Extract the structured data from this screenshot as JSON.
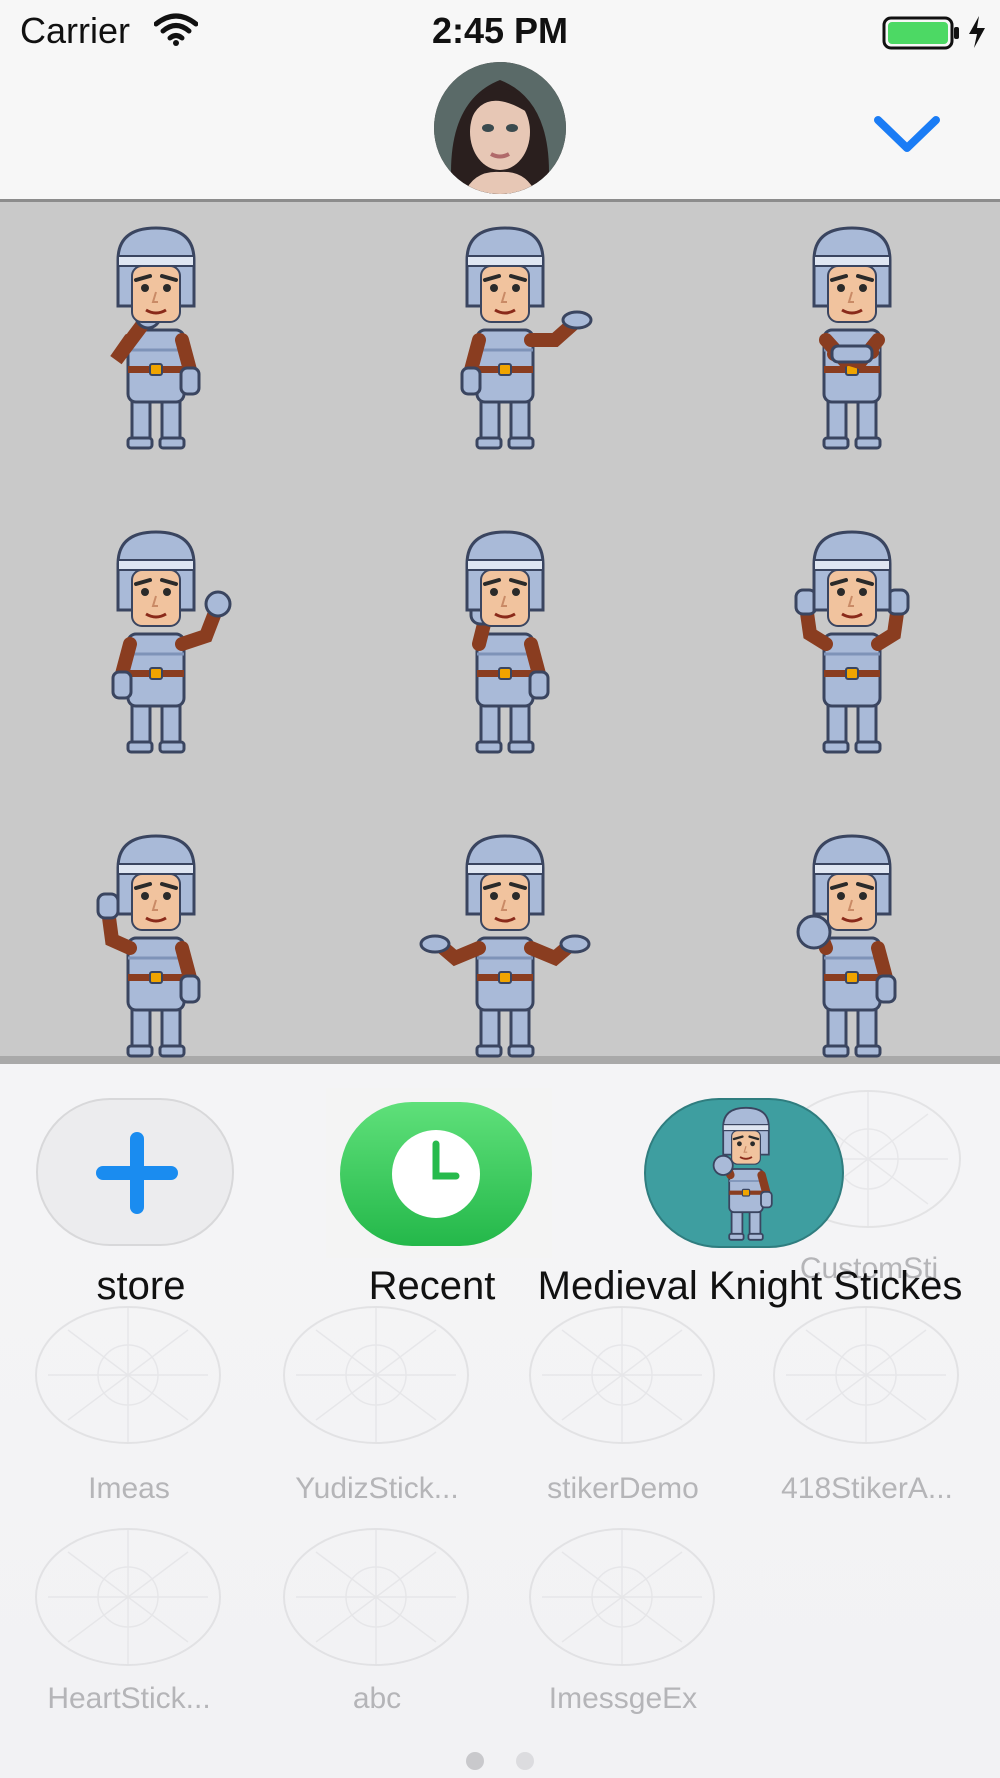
{
  "status_bar": {
    "carrier": "Carrier",
    "time": "2:45 PM",
    "battery_color": "#4cd964"
  },
  "header": {
    "avatar_icon": "contact-avatar",
    "collapse_icon": "chevron-down-icon",
    "accent": "#1a7cf5"
  },
  "stickers": [
    {
      "pose": "thinking"
    },
    {
      "pose": "presenting"
    },
    {
      "pose": "arms-crossed"
    },
    {
      "pose": "ok-gesture"
    },
    {
      "pose": "stop-hand"
    },
    {
      "pose": "celebrating"
    },
    {
      "pose": "peace-sign"
    },
    {
      "pose": "shrugging"
    },
    {
      "pose": "pointing"
    }
  ],
  "drawer": {
    "apps": [
      {
        "label": "store",
        "icon": "plus-icon"
      },
      {
        "label": "Recent",
        "icon": "clock-icon"
      },
      {
        "label": "Medieval Knight Stickes",
        "icon": "knight-sticker-icon"
      }
    ],
    "ghost_apps": [
      {
        "label": "CustomSti"
      },
      {
        "label": "Imeas"
      },
      {
        "label": "YudizStick..."
      },
      {
        "label": "stikerDemo"
      },
      {
        "label": "418StikerA..."
      },
      {
        "label": "HeartStick..."
      },
      {
        "label": "abc"
      },
      {
        "label": "ImessgeEx"
      }
    ],
    "page_count": 2,
    "current_page": 1
  }
}
